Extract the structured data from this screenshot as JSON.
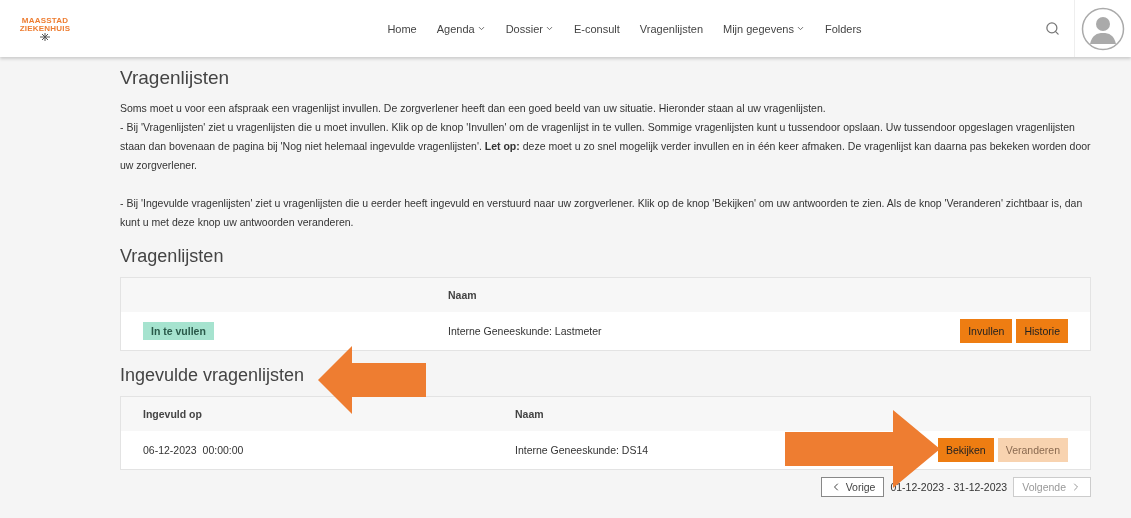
{
  "header": {
    "logo": {
      "line1": "MAASSTAD",
      "line2": "ZIEKENHUIS"
    },
    "nav": [
      {
        "label": "Home",
        "dropdown": false
      },
      {
        "label": "Agenda",
        "dropdown": true
      },
      {
        "label": "Dossier",
        "dropdown": true
      },
      {
        "label": "E-consult",
        "dropdown": false
      },
      {
        "label": "Vragenlijsten",
        "dropdown": false
      },
      {
        "label": "Mijn gegevens",
        "dropdown": true
      },
      {
        "label": "Folders",
        "dropdown": false
      }
    ]
  },
  "page_title": "Vragenlijsten",
  "intro": [
    "Soms moet u voor een afspraak een vragenlijst invullen. De zorgverlener heeft dan een goed beeld van uw situatie. Hieronder staan al uw vragenlijsten.",
    "- Bij 'Vragenlijsten' ziet u vragenlijsten die u moet invullen. Klik op de knop 'Invullen' om de vragenlijst in te vullen. Sommige vragenlijsten kunt u tussendoor opslaan. Uw tussendoor opgeslagen vragenlijsten staan dan bovenaan de pagina bij 'Nog niet helemaal ingevulde vragenlijsten'. **Let op:** deze moet u zo snel mogelijk verder invullen en in één keer afmaken. De vragenlijst kan daarna pas bekeken worden door uw zorgverlener.",
    "- Bij 'Ingevulde vragenlijsten' ziet u vragenlijsten die u eerder heeft ingevuld en verstuurd naar uw zorgverlener. Klik op de knop 'Bekijken' om uw antwoorden te zien. Als de knop 'Veranderen' zichtbaar is, dan kunt u met deze knop uw antwoorden veranderen."
  ],
  "todo": {
    "title": "Vragenlijsten",
    "columns": [
      "Naam"
    ],
    "rows": [
      {
        "status": "In te vullen",
        "name": "Interne Geneeskunde: Lastmeter",
        "buttons": [
          {
            "label": "Invullen",
            "disabled": false
          },
          {
            "label": "Historie",
            "disabled": false
          }
        ]
      }
    ]
  },
  "done": {
    "title": "Ingevulde vragenlijsten",
    "columns": [
      "Ingevuld op",
      "Naam"
    ],
    "rows": [
      {
        "date": "06-12-2023  00:00:00",
        "name": "Interne Geneeskunde: DS14",
        "buttons": [
          {
            "label": "Bekijken",
            "disabled": false
          },
          {
            "label": "Veranderen",
            "disabled": true
          }
        ]
      }
    ],
    "pagination": {
      "prev": "Vorige",
      "range": "01-12-2023 - 31-12-2023",
      "next": "Volgende",
      "prev_disabled": false,
      "next_disabled": true
    }
  }
}
